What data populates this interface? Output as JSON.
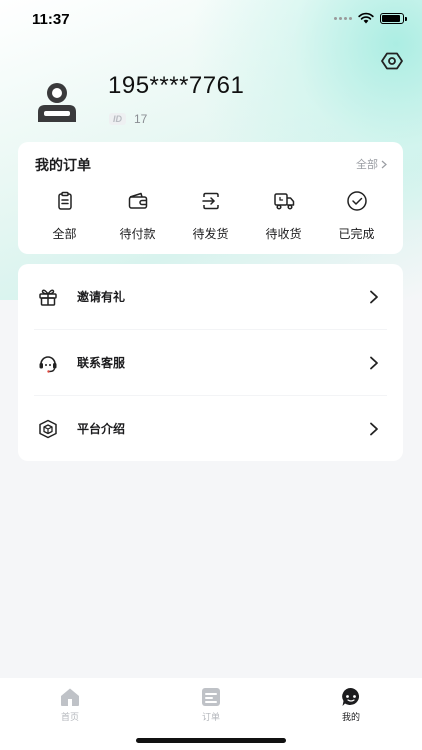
{
  "status": {
    "time": "11:37"
  },
  "profile": {
    "phone": "195****7761",
    "id_badge": "ID",
    "id_value": "17"
  },
  "orders": {
    "title": "我的订单",
    "view_all": "全部",
    "items": [
      {
        "label": "全部",
        "icon": "clipboard-icon"
      },
      {
        "label": "待付款",
        "icon": "wallet-icon"
      },
      {
        "label": "待发货",
        "icon": "box-send-icon"
      },
      {
        "label": "待收货",
        "icon": "delivery-truck-icon"
      },
      {
        "label": "已完成",
        "icon": "check-circle-icon"
      }
    ]
  },
  "menu": {
    "items": [
      {
        "label": "邀请有礼",
        "icon": "gift-icon"
      },
      {
        "label": "联系客服",
        "icon": "headset-icon"
      },
      {
        "label": "平台介绍",
        "icon": "cube-icon"
      }
    ]
  },
  "tabbar": {
    "items": [
      {
        "label": "首页",
        "icon": "home-icon",
        "active": false
      },
      {
        "label": "订单",
        "icon": "order-list-icon",
        "active": false
      },
      {
        "label": "我的",
        "icon": "profile-chat-icon",
        "active": true
      }
    ]
  },
  "colors": {
    "accent_gradient": "#d8f3ee",
    "text_primary": "#1c1c1e",
    "text_muted": "#9a9da3",
    "inactive_tab": "#b4b7bc"
  }
}
